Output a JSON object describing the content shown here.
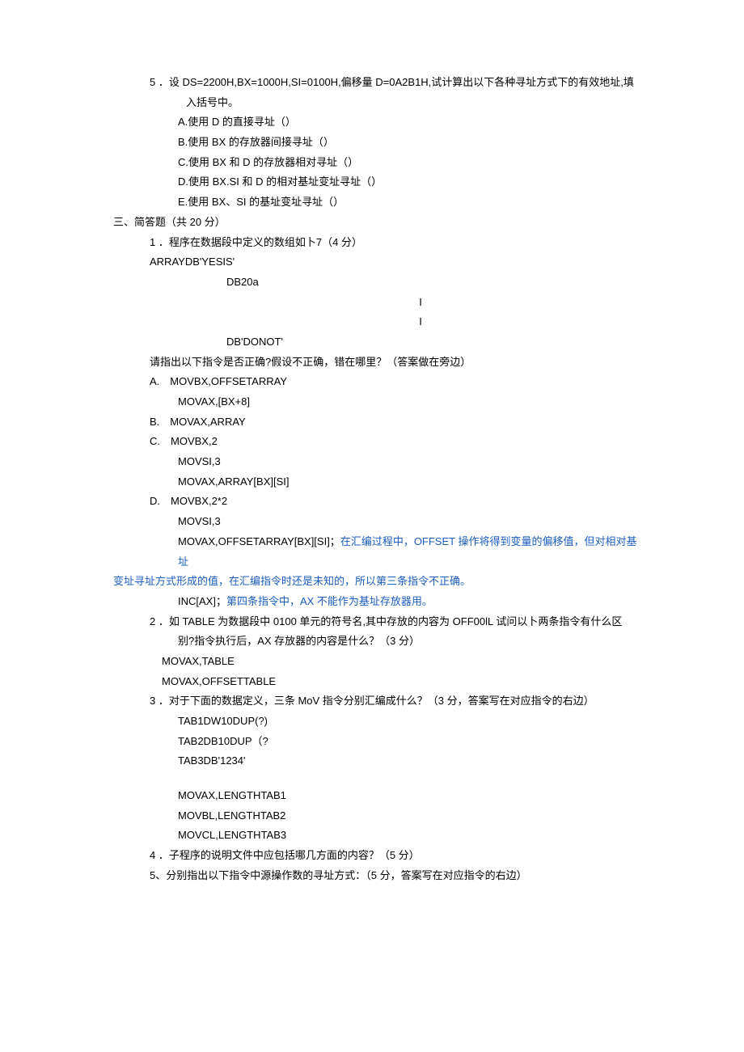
{
  "q5": {
    "num": "5 ．",
    "stem_a": "设 DS=2200H,BX=1000H,SI=0100H,偏移量 D=0A2B1H,试计算出以下各种寻址方式下的有效地址,填",
    "stem_b": "入括号中。",
    "A": "A.使用 D 的直接寻址（）",
    "B": "B.使用 BX 的存放器间接寻址（）",
    "C": "C.使用 BX 和 D 的存放器相对寻址（）",
    "D": "D.使用 BX.SI 和 D 的相对基址变址寻址（）",
    "E": "E.使用 BX、SI 的基址变址寻址（）"
  },
  "sec3": "三、简答题（共 20 分）",
  "q1": {
    "num": "1 ．",
    "stem": "程序在数据段中定义的数组如卜7（4 分）",
    "arr1": "ARRAYDB'YESIS'",
    "arr2": "DB20a",
    "i1": "I",
    "i2": "I",
    "arr3": "DB'DONOT'",
    "ask": "请指出以下指令是否正确?假设不正确，错在哪里？（答案做在旁边）",
    "A": {
      "h": "A.　MOVBX,OFFSETARRAY",
      "l1": "MOVAX,[BX+8]"
    },
    "B": {
      "h": "B.　MOVAX,ARRAY"
    },
    "C": {
      "h": "C.　MOVBX,2",
      "l1": "MOVSI,3",
      "l2": "MOVAX,ARRAY[BX][SI]"
    },
    "D": {
      "h": "D.　MOVBX,2*2",
      "l1": "MOVSI,3",
      "l2a": "MOVAX,OFFSETARRAY[BX][SI]；",
      "l2b": "在汇编过程中，OFFSET 操作将得到变量的偏移值，但对相对基址",
      "l3": "变址寻址方式形成的值，在汇编指令时还是未知的，所以第三条指令不正确。",
      "l4a": "INC[AX]；",
      "l4b": "第四条指令中，AX 不能作为基址存放器用。"
    }
  },
  "q2": {
    "num": "2 ．",
    "stem_a": "如 TABLE 为数据段中 0100 单元的符号名,其中存放的内容为 OFF00lL 试问以卜两条指令有什么区",
    "stem_b": "别?指令执行后，AX 存放器的内容是什么？（3 分）",
    "l1": "MOVAX,TABLE",
    "l2": "MOVAX,OFFSETTABLE"
  },
  "q3": {
    "num": "3 ．",
    "stem": "对于下面的数据定义，三条 MoV 指令分别汇编成什么？（3 分，答案写在对应指令的右边）",
    "t1": "TAB1DW10DUP(?)",
    "t2": "TAB2DB10DUP（?",
    "t3": "TAB3DB'1234'",
    "m1": "MOVAX,LENGTHTAB1",
    "m2": "MOVBL,LENGTHTAB2",
    "m3": "MOVCL,LENGTHTAB3"
  },
  "q4": {
    "num": "4 ．",
    "stem": "子程序的说明文件中应包括哪几方面的内容？（5 分）"
  },
  "q5b": {
    "num": "5、",
    "stem": "分别指出以下指令中源操作数的寻址方式：（5 分，答案写在对应指令的右边）"
  }
}
